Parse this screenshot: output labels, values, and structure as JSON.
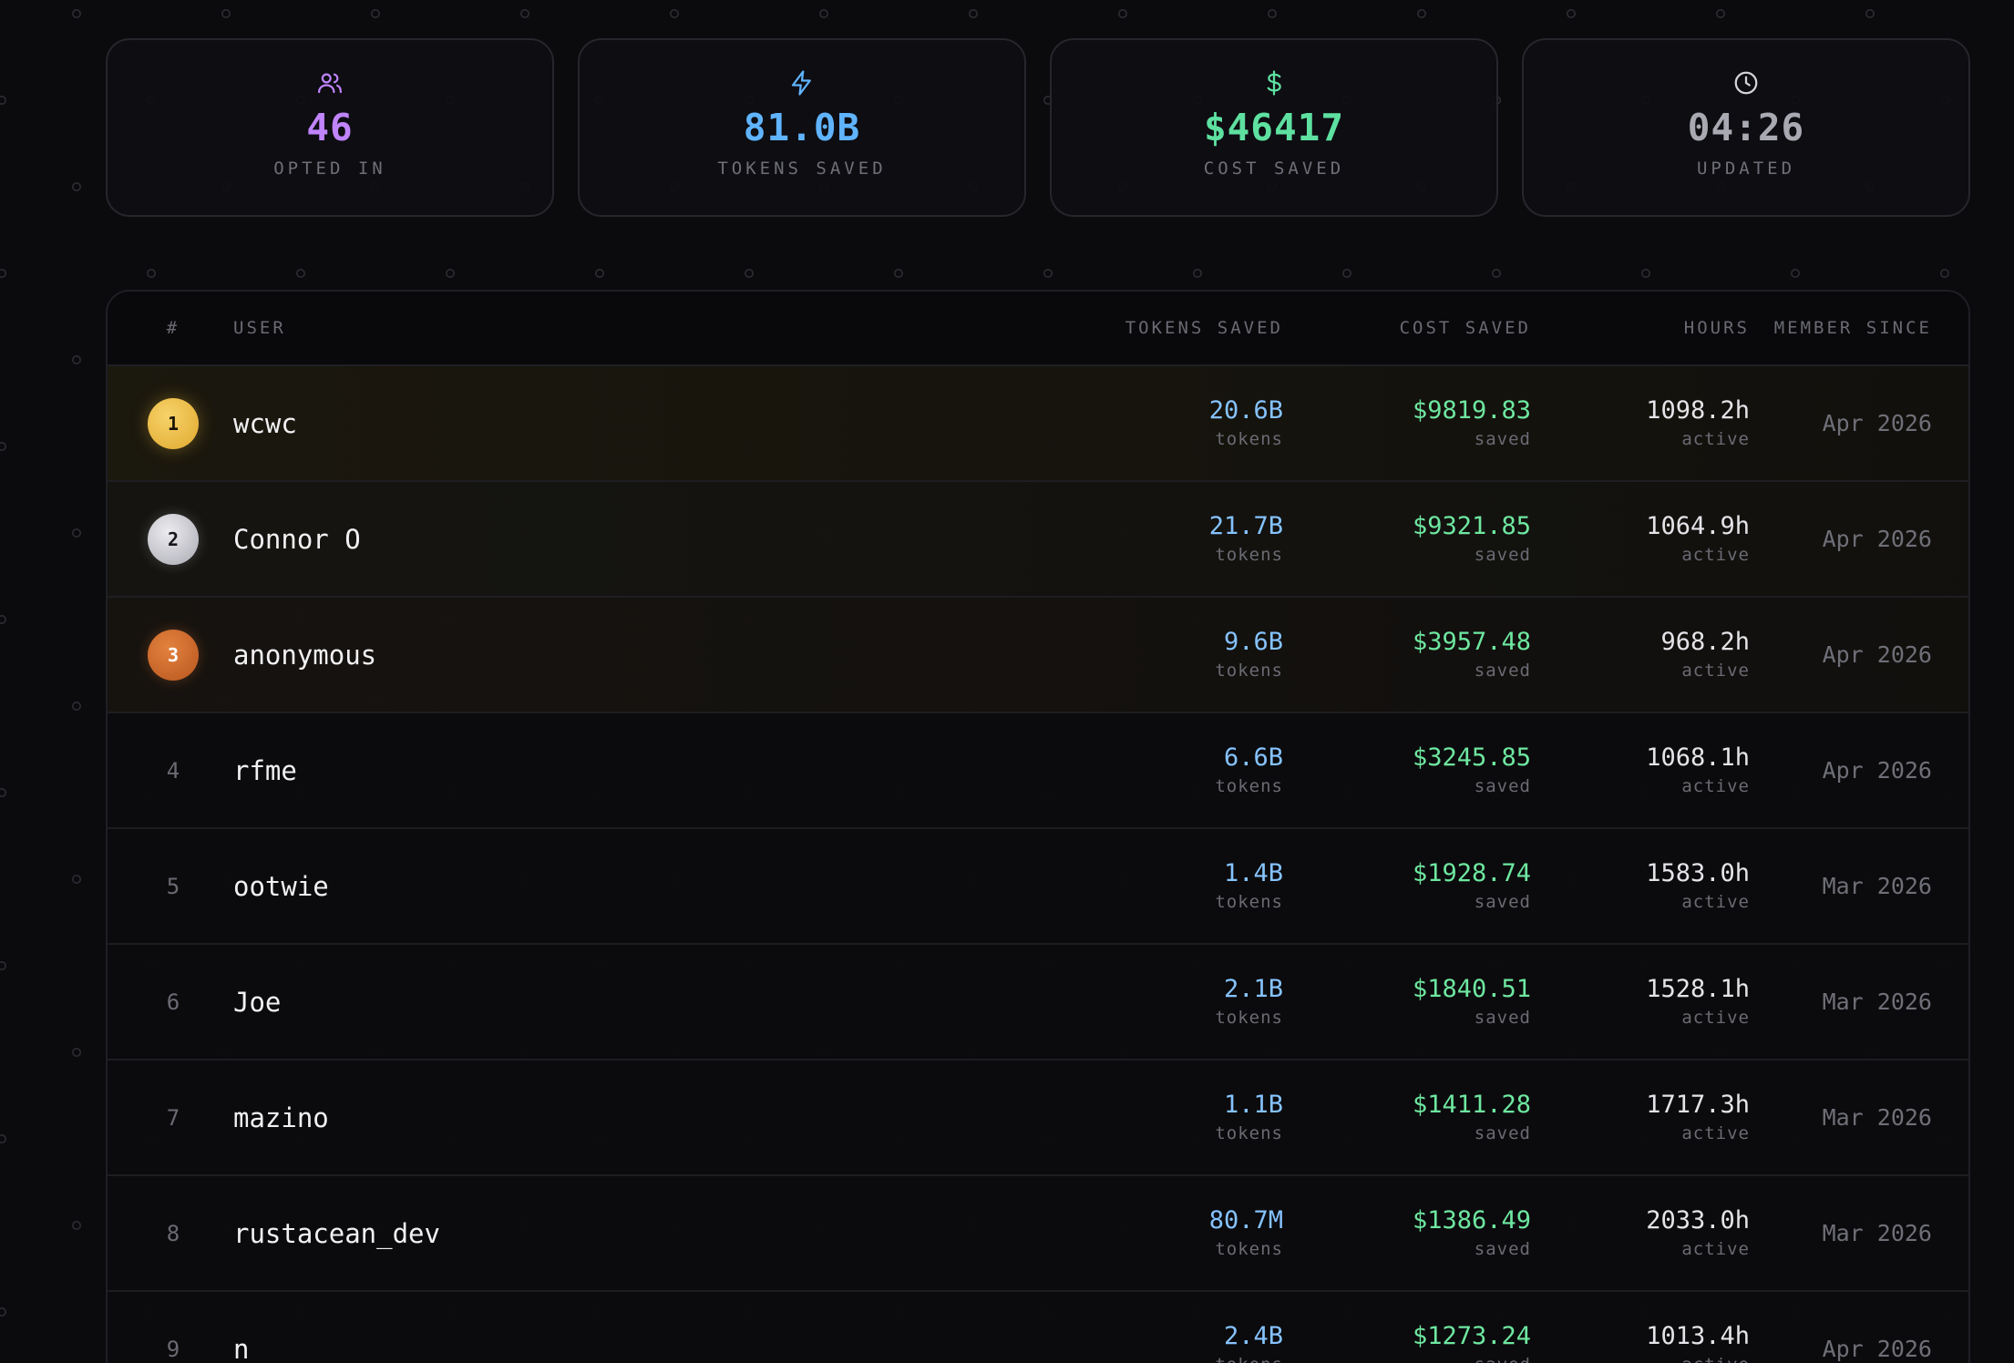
{
  "stats": [
    {
      "icon": "users-icon",
      "value": "46",
      "label": "OPTED IN",
      "color": "#c084fc"
    },
    {
      "icon": "lightning-icon",
      "value": "81.0B",
      "label": "TOKENS SAVED",
      "color": "#60b4ff"
    },
    {
      "icon": "dollar-icon",
      "value": "$46417",
      "label": "COST SAVED",
      "color": "#5ee0a0"
    },
    {
      "icon": "clock-icon",
      "value": "04:26",
      "label": "UPDATED",
      "color": "#a9a9b2"
    }
  ],
  "table": {
    "headers": {
      "rank": "#",
      "user": "USER",
      "tokens": "TOKENS SAVED",
      "cost": "COST SAVED",
      "hours": "HOURS",
      "member": "MEMBER SINCE"
    },
    "rows": [
      {
        "rank": "1",
        "user": "wcwc",
        "tokens": "20.6B",
        "tokens_sub": "tokens",
        "cost": "$9819.83",
        "cost_sub": "saved",
        "hours": "1098.2h",
        "hours_sub": "active",
        "member": "Apr 2026"
      },
      {
        "rank": "2",
        "user": "Connor O",
        "tokens": "21.7B",
        "tokens_sub": "tokens",
        "cost": "$9321.85",
        "cost_sub": "saved",
        "hours": "1064.9h",
        "hours_sub": "active",
        "member": "Apr 2026"
      },
      {
        "rank": "3",
        "user": "anonymous",
        "tokens": "9.6B",
        "tokens_sub": "tokens",
        "cost": "$3957.48",
        "cost_sub": "saved",
        "hours": "968.2h",
        "hours_sub": "active",
        "member": "Apr 2026"
      },
      {
        "rank": "4",
        "user": "rfme",
        "tokens": "6.6B",
        "tokens_sub": "tokens",
        "cost": "$3245.85",
        "cost_sub": "saved",
        "hours": "1068.1h",
        "hours_sub": "active",
        "member": "Apr 2026"
      },
      {
        "rank": "5",
        "user": "ootwie",
        "tokens": "1.4B",
        "tokens_sub": "tokens",
        "cost": "$1928.74",
        "cost_sub": "saved",
        "hours": "1583.0h",
        "hours_sub": "active",
        "member": "Mar 2026"
      },
      {
        "rank": "6",
        "user": "Joe",
        "tokens": "2.1B",
        "tokens_sub": "tokens",
        "cost": "$1840.51",
        "cost_sub": "saved",
        "hours": "1528.1h",
        "hours_sub": "active",
        "member": "Mar 2026"
      },
      {
        "rank": "7",
        "user": "mazino",
        "tokens": "1.1B",
        "tokens_sub": "tokens",
        "cost": "$1411.28",
        "cost_sub": "saved",
        "hours": "1717.3h",
        "hours_sub": "active",
        "member": "Mar 2026"
      },
      {
        "rank": "8",
        "user": "rustacean_dev",
        "tokens": "80.7M",
        "tokens_sub": "tokens",
        "cost": "$1386.49",
        "cost_sub": "saved",
        "hours": "2033.0h",
        "hours_sub": "active",
        "member": "Mar 2026"
      },
      {
        "rank": "9",
        "user": "n",
        "tokens": "2.4B",
        "tokens_sub": "tokens",
        "cost": "$1273.24",
        "cost_sub": "saved",
        "hours": "1013.4h",
        "hours_sub": "active",
        "member": "Apr 2026"
      }
    ]
  }
}
